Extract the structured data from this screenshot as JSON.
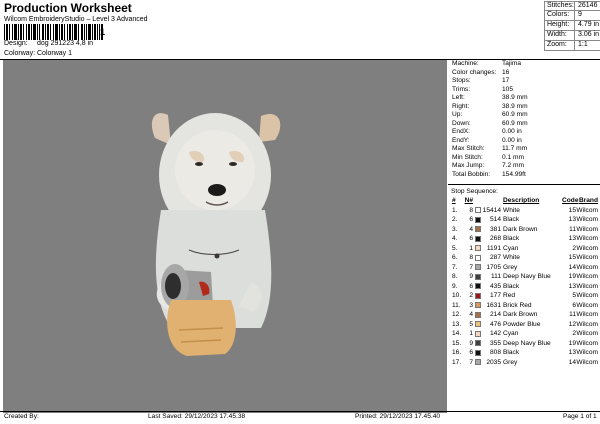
{
  "header": {
    "title": "Production Worksheet",
    "subtitle": "Wilcom EmbroideryStudio – Level 3 Advanced",
    "barcode_tail": "1",
    "design_label": "Design:",
    "design_value": "dog 291223 4,8 in",
    "colorway_label": "Colorway:",
    "colorway_value": "Colorway 1"
  },
  "summary": [
    {
      "k": "Stitches:",
      "v": "26146"
    },
    {
      "k": "Colors:",
      "v": "9"
    },
    {
      "k": "Height:",
      "v": "4.79 in"
    },
    {
      "k": "Width:",
      "v": "3.06 in"
    },
    {
      "k": "Zoom:",
      "v": "1:1"
    }
  ],
  "params": [
    {
      "k": "Machine:",
      "v": "Tajima"
    },
    {
      "k": "Color changes:",
      "v": "16"
    },
    {
      "k": "Stops:",
      "v": "17"
    },
    {
      "k": "Trims:",
      "v": "105"
    },
    {
      "k": "Left:",
      "v": "38.9 mm"
    },
    {
      "k": "Right:",
      "v": "38.9 mm"
    },
    {
      "k": "Up:",
      "v": "60.9 mm"
    },
    {
      "k": "Down:",
      "v": "60.9 mm"
    },
    {
      "k": "EndX:",
      "v": "0.00 in"
    },
    {
      "k": "EndY:",
      "v": "0.00 in"
    },
    {
      "k": "Max Stitch:",
      "v": "11.7 mm"
    },
    {
      "k": "Min Stitch:",
      "v": "0.1 mm"
    },
    {
      "k": "Max Jump:",
      "v": "7.2 mm"
    },
    {
      "k": "Total Bobbin:",
      "v": "154.99ft"
    }
  ],
  "stop_sequence": {
    "heading": "Stop Sequence:",
    "headers": {
      "stop": "#",
      "n": "N#",
      "color": "",
      "stitches": "",
      "description": "Description",
      "code": "Code",
      "brand": "Brand"
    },
    "rows": [
      {
        "stop": "1.",
        "n": "8",
        "color": "#ffffff",
        "stitches": "15414",
        "desc": "White",
        "code": "15",
        "brand": "Wilcom"
      },
      {
        "stop": "2.",
        "n": "6",
        "color": "#111111",
        "stitches": "514",
        "desc": "Black",
        "code": "13",
        "brand": "Wilcom"
      },
      {
        "stop": "3.",
        "n": "4",
        "color": "#a4724a",
        "stitches": "381",
        "desc": "Dark Brown",
        "code": "11",
        "brand": "Wilcom"
      },
      {
        "stop": "4.",
        "n": "6",
        "color": "#111111",
        "stitches": "268",
        "desc": "Black",
        "code": "13",
        "brand": "Wilcom"
      },
      {
        "stop": "5.",
        "n": "1",
        "color": "#f6d7c2",
        "stitches": "1191",
        "desc": "Cyan",
        "code": "2",
        "brand": "Wilcom"
      },
      {
        "stop": "6.",
        "n": "8",
        "color": "#ffffff",
        "stitches": "287",
        "desc": "White",
        "code": "15",
        "brand": "Wilcom"
      },
      {
        "stop": "7.",
        "n": "7",
        "color": "#a8a8a8",
        "stitches": "1705",
        "desc": "Grey",
        "code": "14",
        "brand": "Wilcom"
      },
      {
        "stop": "8.",
        "n": "9",
        "color": "#3f3f3f",
        "stitches": "111",
        "desc": "Deep Navy Blue",
        "code": "19",
        "brand": "Wilcom"
      },
      {
        "stop": "9.",
        "n": "6",
        "color": "#111111",
        "stitches": "435",
        "desc": "Black",
        "code": "13",
        "brand": "Wilcom"
      },
      {
        "stop": "10.",
        "n": "2",
        "color": "#9c1a1a",
        "stitches": "177",
        "desc": "Red",
        "code": "5",
        "brand": "Wilcom"
      },
      {
        "stop": "11.",
        "n": "3",
        "color": "#d89a5a",
        "stitches": "1631",
        "desc": "Brick Red",
        "code": "6",
        "brand": "Wilcom"
      },
      {
        "stop": "12.",
        "n": "4",
        "color": "#a4724a",
        "stitches": "214",
        "desc": "Dark Brown",
        "code": "11",
        "brand": "Wilcom"
      },
      {
        "stop": "13.",
        "n": "5",
        "color": "#f2c27c",
        "stitches": "476",
        "desc": "Powder Blue",
        "code": "12",
        "brand": "Wilcom"
      },
      {
        "stop": "14.",
        "n": "1",
        "color": "#f6d7c2",
        "stitches": "142",
        "desc": "Cyan",
        "code": "2",
        "brand": "Wilcom"
      },
      {
        "stop": "15.",
        "n": "9",
        "color": "#3f3f3f",
        "stitches": "355",
        "desc": "Deep Navy Blue",
        "code": "19",
        "brand": "Wilcom"
      },
      {
        "stop": "16.",
        "n": "6",
        "color": "#111111",
        "stitches": "808",
        "desc": "Black",
        "code": "13",
        "brand": "Wilcom"
      },
      {
        "stop": "17.",
        "n": "7",
        "color": "#a8a8a8",
        "stitches": "2035",
        "desc": "Grey",
        "code": "14",
        "brand": "Wilcom"
      }
    ]
  },
  "footer": {
    "created_by": "Created By:",
    "last_saved": "Last Saved: 29/12/2023 17.45.38",
    "printed": "Printed: 29/12/2023 17.45.40",
    "page": "Page 1 of 1"
  },
  "canvas_bg": "#7f7f7f"
}
